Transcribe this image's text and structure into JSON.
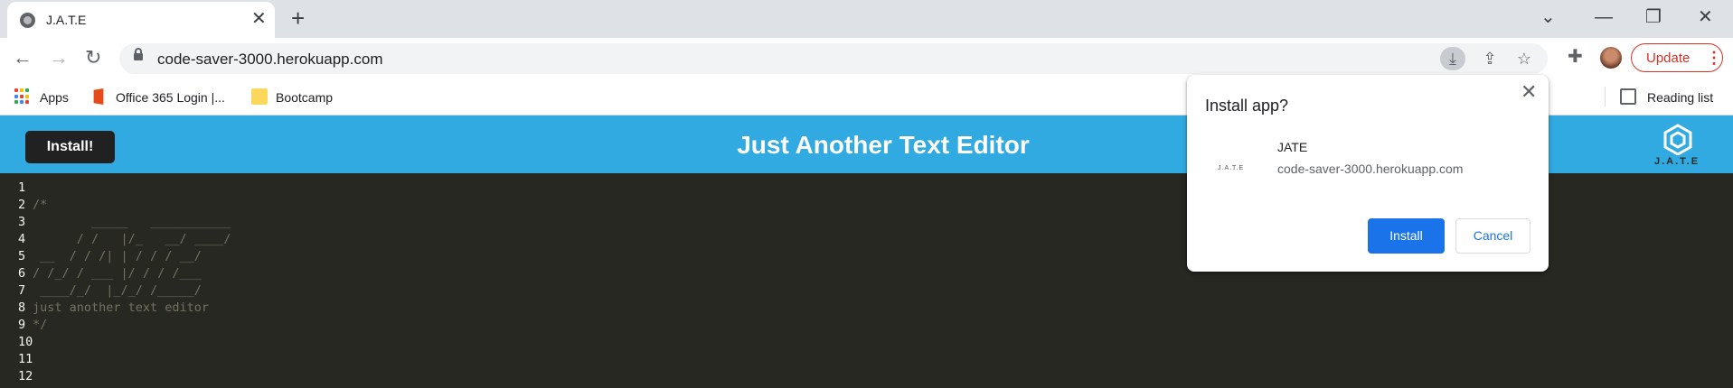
{
  "browser": {
    "tab": {
      "title": "J.A.T.E",
      "close": "✕"
    },
    "new_tab": "+",
    "window": {
      "dropdown": "⌄",
      "minimize": "—",
      "restore": "❐",
      "close": "✕"
    },
    "nav": {
      "back": "←",
      "forward": "→",
      "reload": "↻"
    },
    "address": {
      "url": "code-saver-3000.herokuapp.com"
    },
    "omnibox_icons": {
      "install": "⤓",
      "share": "⇪",
      "bookmark": "☆"
    },
    "extensions_icon": "✚",
    "update": {
      "label": "Update",
      "menu": "⋮"
    },
    "bookmarks": [
      {
        "label": "Apps",
        "icon": "apps-grid-icon"
      },
      {
        "label": "Office 365 Login |...",
        "icon": "office-icon"
      },
      {
        "label": "Bootcamp",
        "icon": "folder-icon"
      }
    ],
    "reading_list": "Reading list"
  },
  "app": {
    "install_label": "Install!",
    "title": "Just Another Text Editor",
    "logo_text": "J.A.T.E"
  },
  "editor": {
    "lines": [
      {
        "n": "1",
        "text": ""
      },
      {
        "n": "2",
        "text": "/*"
      },
      {
        "n": "3",
        "text": "        _____   ___________"
      },
      {
        "n": "4",
        "text": "      / /   |/_   __/ ____/"
      },
      {
        "n": "5",
        "text": " __  / / /| | / / / __/"
      },
      {
        "n": "6",
        "text": "/ /_/ / ___ |/ / / /___"
      },
      {
        "n": "7",
        "text": " ____/_/  |_/_/ /_____/"
      },
      {
        "n": "8",
        "text": "just another text editor"
      },
      {
        "n": "9",
        "text": "*/"
      },
      {
        "n": "10",
        "text": ""
      },
      {
        "n": "11",
        "text": ""
      },
      {
        "n": "12",
        "text": ""
      }
    ]
  },
  "install_dialog": {
    "title": "Install app?",
    "close": "✕",
    "icon_text": "J.A.T.E",
    "app_name": "JATE",
    "app_origin": "code-saver-3000.herokuapp.com",
    "install_label": "Install",
    "cancel_label": "Cancel"
  },
  "colors": {
    "header": "#31a9e1",
    "editor_bg": "#272822",
    "primary_button": "#1a73e8",
    "update_red": "#d93025"
  }
}
